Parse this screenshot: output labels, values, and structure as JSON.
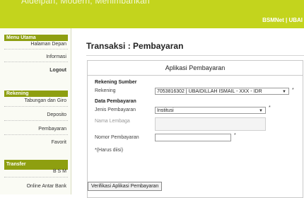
{
  "header": {
    "title_fragment": "Aldelpan, Modern, Menimbankan",
    "user_label": "BSMNet | UBAI"
  },
  "sidebar": {
    "sections": [
      {
        "title": "Menu Utama",
        "items": [
          "Halaman Depan",
          "Informasi",
          "Logout"
        ]
      },
      {
        "title": "Rekening",
        "items": [
          "Tabungan dan Giro",
          "Deposito",
          "Pembayaran",
          "Favorit"
        ]
      },
      {
        "title": "Transfer",
        "items": [
          "B S M",
          "Online Antar Bank"
        ]
      }
    ]
  },
  "main": {
    "page_title": "Transaksi : Pembayaran",
    "panel_title": "Aplikasi Pembayaran",
    "rekening_sumber_heading": "Rekening Sumber",
    "rekening_label": "Rekening",
    "rekening_value": "7053816302 | UBAIDILLAH ISMAIL - XXX - IDR",
    "data_pembayaran_heading": "Data Pembayaran",
    "jenis_label": "Jenis Pembayaran",
    "jenis_value": "Institusi",
    "nama_lembaga_label": "Nama Lembaga",
    "nomor_label": "Nomor Pembayaran",
    "nomor_value": "",
    "required_mark": "*",
    "required_note": "*(Harus diisi)",
    "submit_label": "Verifikasi Aplikasi Pembayaran"
  }
}
